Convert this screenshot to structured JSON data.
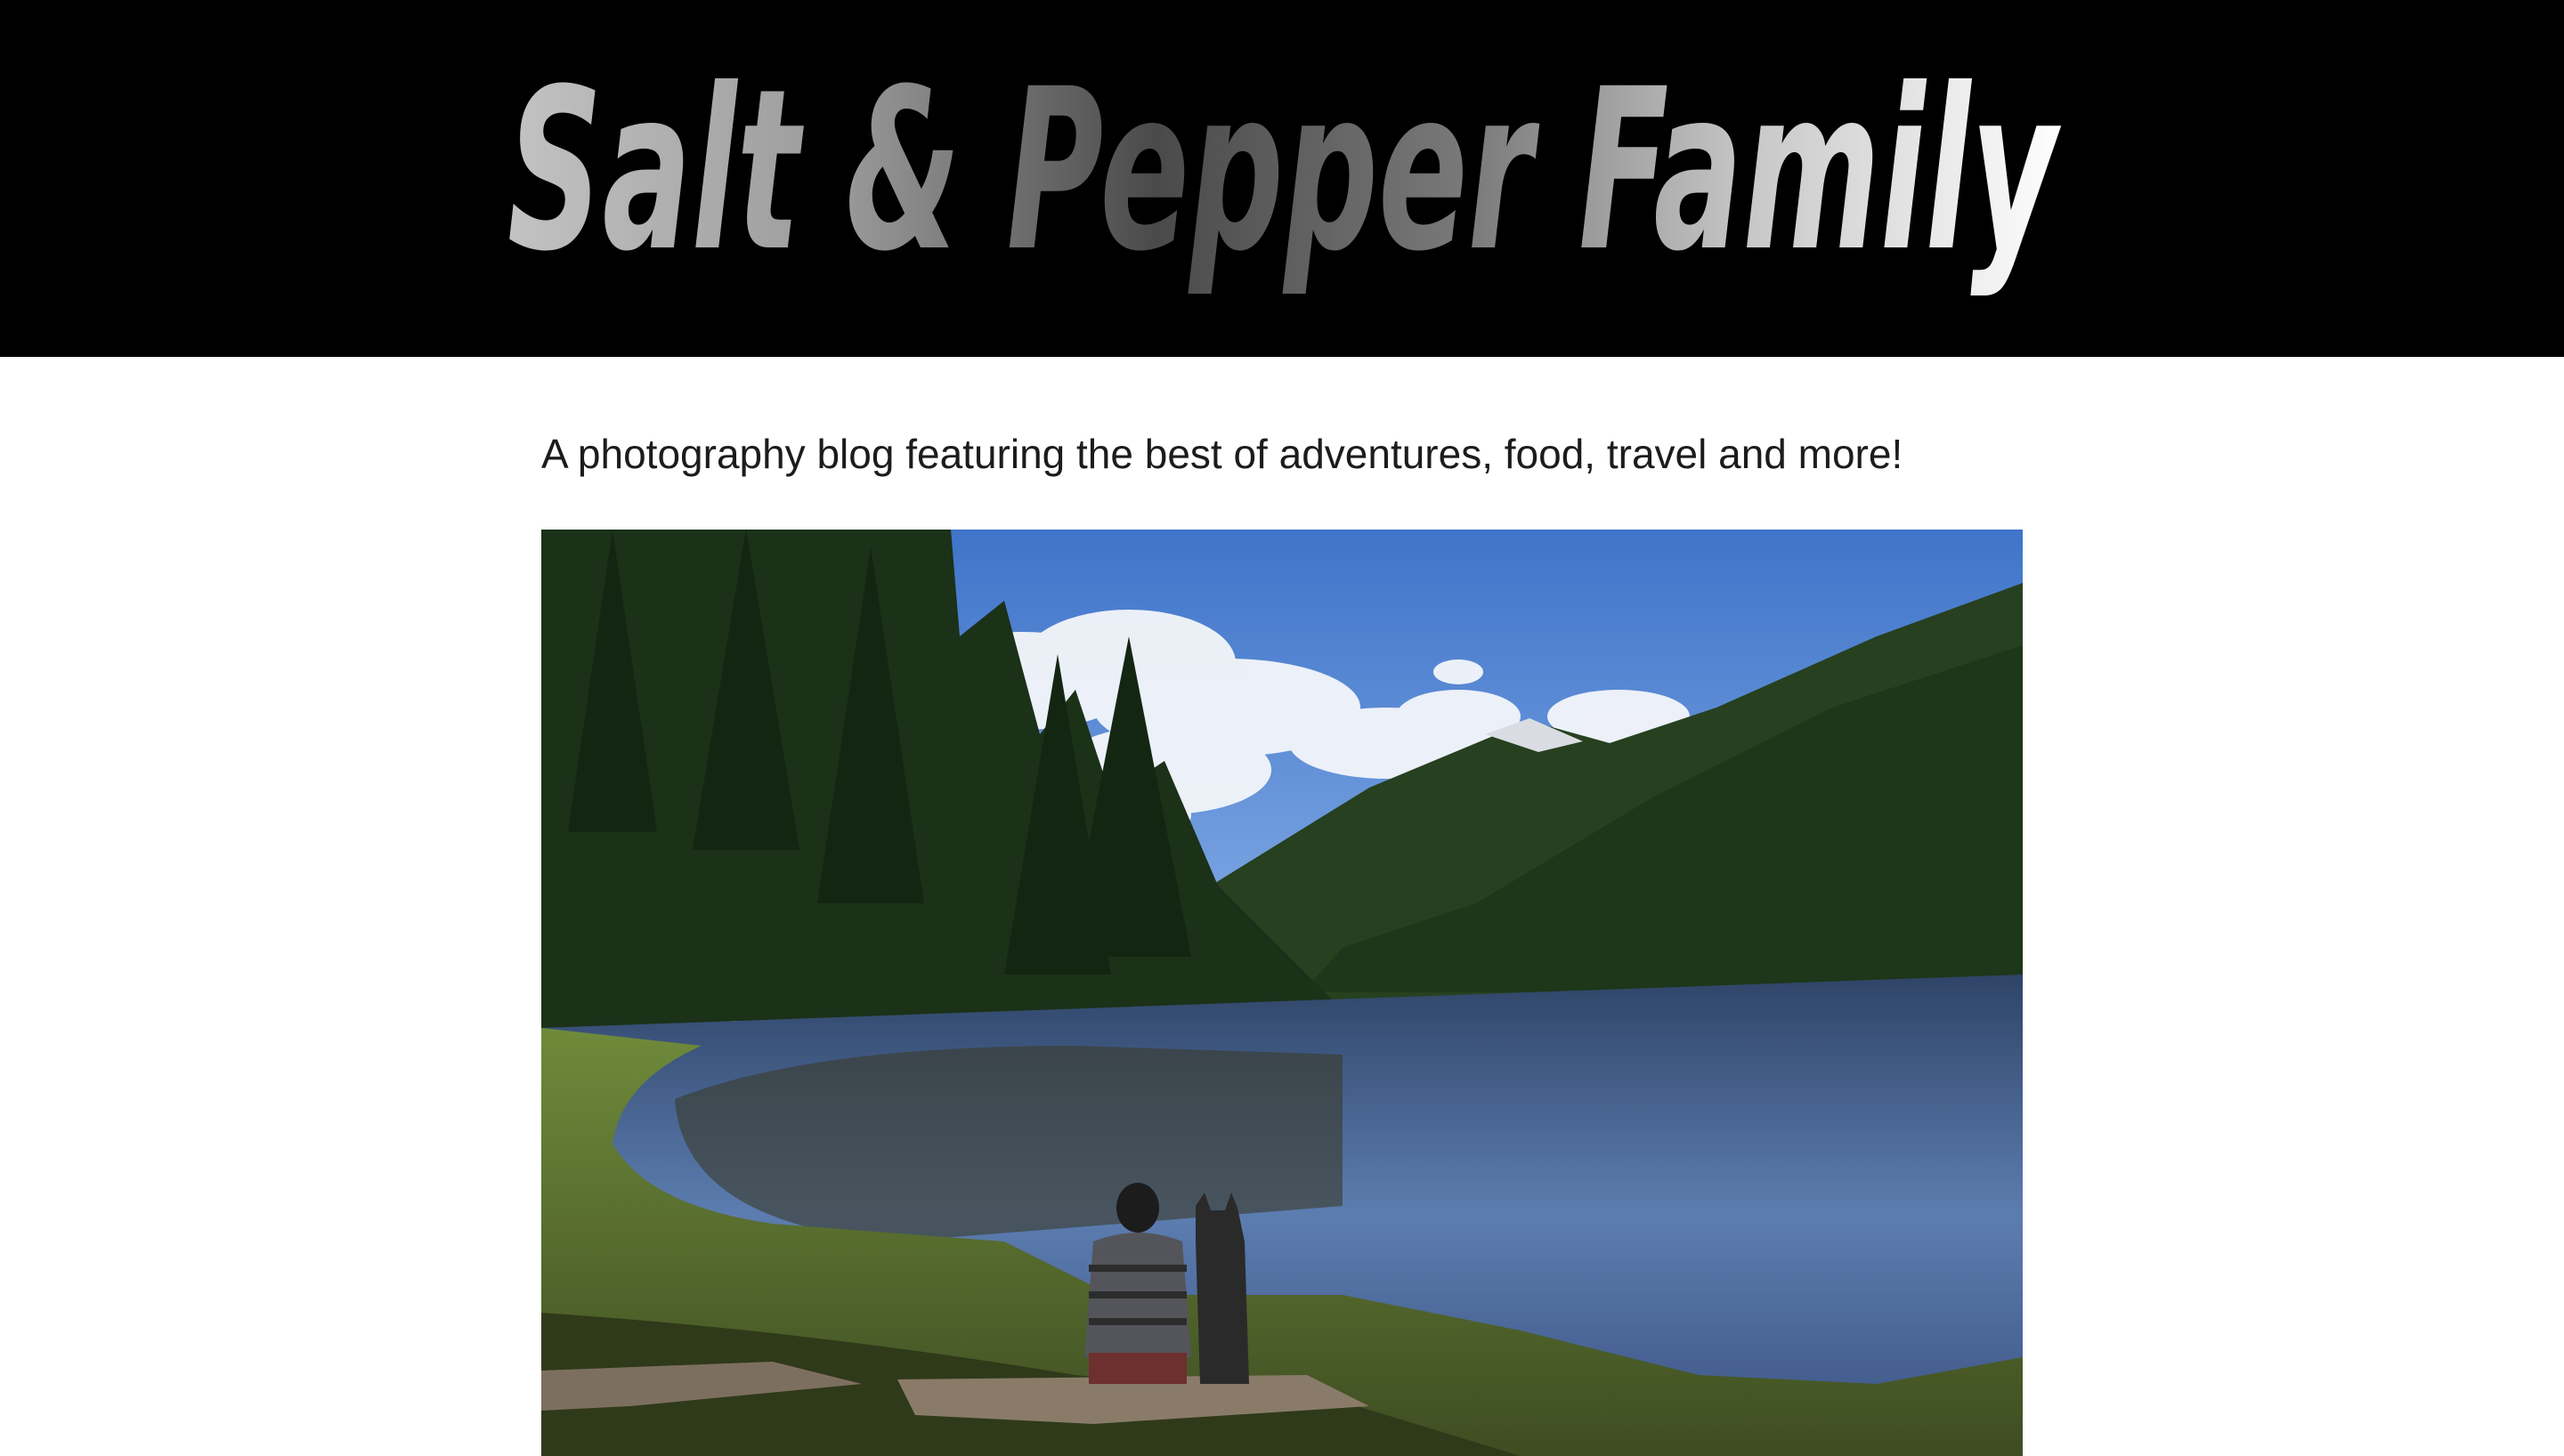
{
  "header": {
    "logo_text": "Salt & Pepper Family",
    "background_color": "#000000",
    "logo_gradient": [
      "#bdbdbd",
      "#4a4a4a",
      "#ffffff"
    ]
  },
  "main": {
    "tagline": "A photography blog featuring the best of adventures, food, travel and more!",
    "hero_image": {
      "icon": "photo-icon",
      "subject": "person and dog by mountain lake",
      "sky_color": "#5b8fd6",
      "forest_color": "#1f3a1c",
      "water_color": "#4d6c9b"
    }
  }
}
